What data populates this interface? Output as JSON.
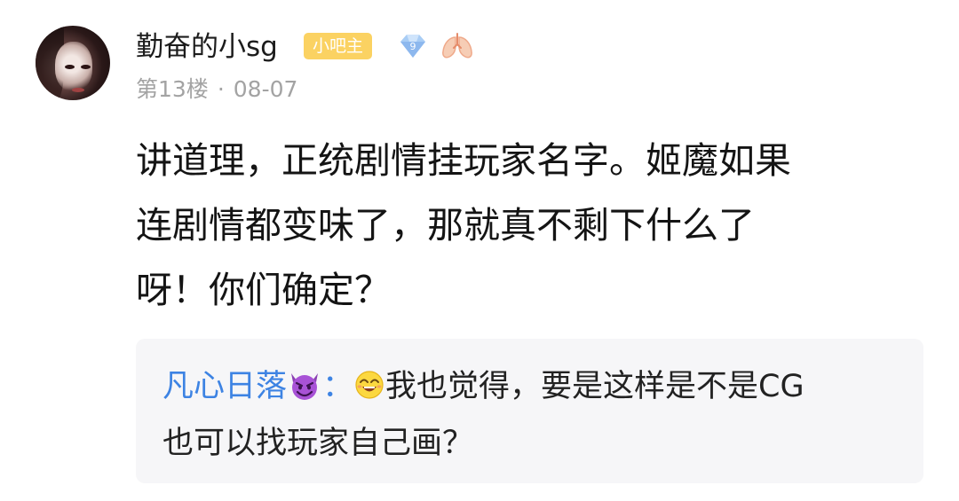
{
  "post": {
    "username": "勤奋的小sg",
    "role_badge": "小吧主",
    "level_badge": "9",
    "floor": "第13楼",
    "separator": "·",
    "date": "08-07",
    "content_lines": [
      "讲道理，正统剧情挂玩家名字。姬魔如果",
      "连剧情都变味了，那就真不剩下什么了",
      "呀！你们确定？"
    ],
    "icons": {
      "avatar": "user-avatar",
      "level": "diamond-level-icon",
      "honor": "lung-icon"
    },
    "colors": {
      "badge": "#fbd262",
      "reply_name": "#3d83e3",
      "reply_bg": "#f6f6f8",
      "meta": "#a3a3a3"
    }
  },
  "reply": {
    "name": "凡心日落",
    "name_emoji": "purple-devil-emoji",
    "colon": "：",
    "text_emoji": "laughing-face-emoji",
    "text_line1": "我也觉得，要是这样是不是CG",
    "text_line2": "也可以找玩家自己画？"
  }
}
